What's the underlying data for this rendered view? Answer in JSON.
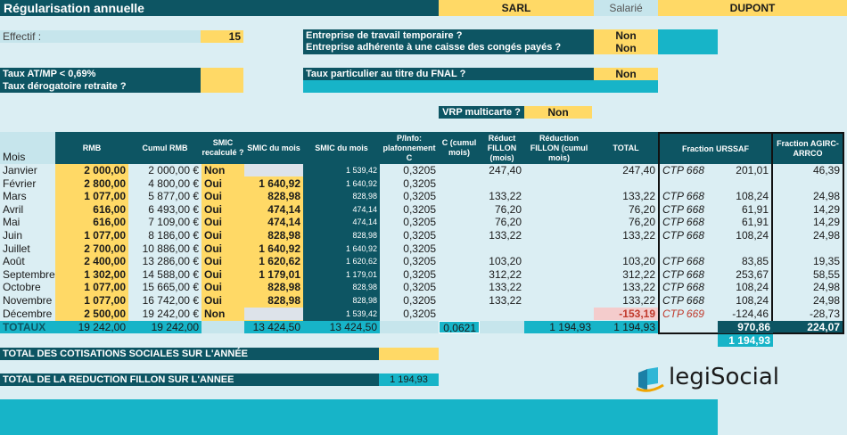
{
  "title": "Régularisation annuelle",
  "company": {
    "type": "SARL",
    "role": "Salarié",
    "name": "DUPONT"
  },
  "effectif": {
    "label": "Effectif :",
    "value": "15"
  },
  "questions": {
    "travail_temp": {
      "label": "Entreprise de travail temporaire ?",
      "value": "Non"
    },
    "conges": {
      "label": "Entreprise adhérente à une caisse des congés payés ?",
      "value": "Non"
    },
    "atmp": {
      "label": "Taux AT/MP < 0,69%"
    },
    "derog": {
      "label": "Taux dérogatoire retraite ?"
    },
    "fnal": {
      "label": "Taux particulier au titre du FNAL ?",
      "value": "Non"
    },
    "vrp": {
      "label": "VRP multicarte ?",
      "value": "Non"
    }
  },
  "table": {
    "headers": {
      "mois": "Mois",
      "rmb": "RMB",
      "cumul": "Cumul RMB",
      "smic_recalc": "SMIC recalculé ?",
      "smic_mois": "SMIC du mois",
      "smic_mois2": "SMIC du mois",
      "plafond": "P/Info: plafonnement C",
      "c_cumul": "C (cumul mois)",
      "reduct": "Réduct FILLON (mois)",
      "reduct_cumul": "Réduction FILLON (cumul mois)",
      "total": "TOTAL",
      "urssaf": "Fraction URSSAF",
      "agirc": "Fraction AGIRC-ARRCO"
    },
    "rows": [
      {
        "mois": "Janvier",
        "rmb": "2 000,00",
        "cumul": "2 000,00 €",
        "recalc": "Non",
        "smic": "",
        "smic2": "1 539,42",
        "plaf": "0,3205",
        "c": "",
        "red": "247,40",
        "redc": "",
        "total": "247,40",
        "ctp": "CTP 668",
        "urssaf": "201,01",
        "agirc": "46,39"
      },
      {
        "mois": "Février",
        "rmb": "2 800,00",
        "cumul": "4 800,00 €",
        "recalc": "Oui",
        "smic": "1 640,92",
        "smic2": "1 640,92",
        "plaf": "0,3205",
        "c": "",
        "red": "",
        "redc": "",
        "total": "",
        "ctp": "",
        "urssaf": "",
        "agirc": ""
      },
      {
        "mois": "Mars",
        "rmb": "1 077,00",
        "cumul": "5 877,00 €",
        "recalc": "Oui",
        "smic": "828,98",
        "smic2": "828,98",
        "plaf": "0,3205",
        "c": "",
        "red": "133,22",
        "redc": "",
        "total": "133,22",
        "ctp": "CTP 668",
        "urssaf": "108,24",
        "agirc": "24,98"
      },
      {
        "mois": "Avril",
        "rmb": "616,00",
        "cumul": "6 493,00 €",
        "recalc": "Oui",
        "smic": "474,14",
        "smic2": "474,14",
        "plaf": "0,3205",
        "c": "",
        "red": "76,20",
        "redc": "",
        "total": "76,20",
        "ctp": "CTP 668",
        "urssaf": "61,91",
        "agirc": "14,29"
      },
      {
        "mois": "Mai",
        "rmb": "616,00",
        "cumul": "7 109,00 €",
        "recalc": "Oui",
        "smic": "474,14",
        "smic2": "474,14",
        "plaf": "0,3205",
        "c": "",
        "red": "76,20",
        "redc": "",
        "total": "76,20",
        "ctp": "CTP 668",
        "urssaf": "61,91",
        "agirc": "14,29"
      },
      {
        "mois": "Juin",
        "rmb": "1 077,00",
        "cumul": "8 186,00 €",
        "recalc": "Oui",
        "smic": "828,98",
        "smic2": "828,98",
        "plaf": "0,3205",
        "c": "",
        "red": "133,22",
        "redc": "",
        "total": "133,22",
        "ctp": "CTP 668",
        "urssaf": "108,24",
        "agirc": "24,98"
      },
      {
        "mois": "Juillet",
        "rmb": "2 700,00",
        "cumul": "10 886,00 €",
        "recalc": "Oui",
        "smic": "1 640,92",
        "smic2": "1 640,92",
        "plaf": "0,3205",
        "c": "",
        "red": "",
        "redc": "",
        "total": "",
        "ctp": "",
        "urssaf": "",
        "agirc": ""
      },
      {
        "mois": "Août",
        "rmb": "2 400,00",
        "cumul": "13 286,00 €",
        "recalc": "Oui",
        "smic": "1 620,62",
        "smic2": "1 620,62",
        "plaf": "0,3205",
        "c": "",
        "red": "103,20",
        "redc": "",
        "total": "103,20",
        "ctp": "CTP 668",
        "urssaf": "83,85",
        "agirc": "19,35"
      },
      {
        "mois": "Septembre",
        "rmb": "1 302,00",
        "cumul": "14 588,00 €",
        "recalc": "Oui",
        "smic": "1 179,01",
        "smic2": "1 179,01",
        "plaf": "0,3205",
        "c": "",
        "red": "312,22",
        "redc": "",
        "total": "312,22",
        "ctp": "CTP 668",
        "urssaf": "253,67",
        "agirc": "58,55"
      },
      {
        "mois": "Octobre",
        "rmb": "1 077,00",
        "cumul": "15 665,00 €",
        "recalc": "Oui",
        "smic": "828,98",
        "smic2": "828,98",
        "plaf": "0,3205",
        "c": "",
        "red": "133,22",
        "redc": "",
        "total": "133,22",
        "ctp": "CTP 668",
        "urssaf": "108,24",
        "agirc": "24,98"
      },
      {
        "mois": "Novembre",
        "rmb": "1 077,00",
        "cumul": "16 742,00 €",
        "recalc": "Oui",
        "smic": "828,98",
        "smic2": "828,98",
        "plaf": "0,3205",
        "c": "",
        "red": "133,22",
        "redc": "",
        "total": "133,22",
        "ctp": "CTP 668",
        "urssaf": "108,24",
        "agirc": "24,98"
      },
      {
        "mois": "Décembre",
        "rmb": "2 500,00",
        "cumul": "19 242,00 €",
        "recalc": "Non",
        "smic": "",
        "smic2": "1 539,42",
        "plaf": "0,3205",
        "c": "",
        "red": "",
        "redc": "",
        "total": "-153,19",
        "ctp": "CTP 669",
        "urssaf": "-124,46",
        "agirc": "-28,73"
      }
    ],
    "totals": {
      "label": "TOTAUX",
      "rmb": "19 242,00",
      "cumul": "19 242,00",
      "smic": "13 424,50",
      "smic2": "13 424,50",
      "c": "0,0621",
      "redc": "1 194,93",
      "total": "1 194,93",
      "urssaf": "970,86",
      "agirc": "224,07",
      "urssaf_sum": "1 194,93"
    }
  },
  "summary": {
    "cotisations": {
      "label": "TOTAL DES COTISATIONS SOCIALES SUR L'ANNÉE",
      "value": ""
    },
    "fillon": {
      "label": "TOTAL DE LA REDUCTION FILLON SUR L'ANNEE",
      "value": "1 194,93"
    }
  },
  "logo": {
    "text": "legiSocial"
  },
  "colors": {
    "dark": "#0d5563",
    "yellow": "#ffd966",
    "teal": "#17b4c8",
    "light": "#c6e5ec",
    "bg": "#dbeef3",
    "red": "#c0392b"
  }
}
